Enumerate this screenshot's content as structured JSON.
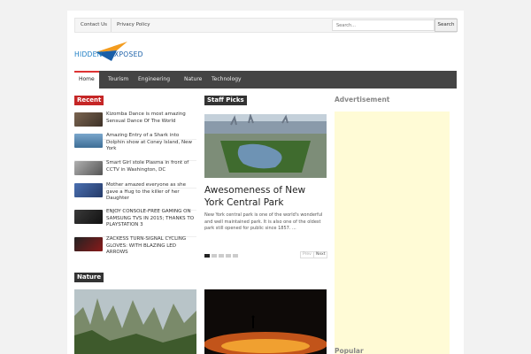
{
  "topbar": {
    "links": [
      "Contact Us",
      "Privacy Policy"
    ],
    "search_placeholder": "Search...",
    "search_button": "Search"
  },
  "logo": {
    "word1": "HIDDEN",
    "word2": "EXPOSED"
  },
  "nav": {
    "items": [
      "Home",
      "Tourism",
      "Engineering",
      "Nature",
      "Technology"
    ],
    "active": "Home"
  },
  "sections": {
    "recent": "Recent",
    "staff_picks": "Staff Picks",
    "nature": "Nature",
    "advertisement": "Advertisement",
    "popular": "Popular"
  },
  "recent_posts": [
    {
      "title": "Kizomba Dance is most amazing Sensual Dance Of The World",
      "thumb_color": "#6b5a4a"
    },
    {
      "title": "Amazing Entry of a Shark into Dolphin show at Coney Island, New York",
      "thumb_color": "#4f7fa8"
    },
    {
      "title": "Smart Girl stole Plasma in front of CCTV in Washington, DC",
      "thumb_color": "#8a8a8a"
    },
    {
      "title": "Mother amazed everyone as she gave a Hug to the killer of her Daughter",
      "thumb_color": "#3b5a9a"
    },
    {
      "title": "ENJOY CONSOLE-FREE GAMING ON SAMSUNG TVS IN 2015; THANKS TO PLAYSTATION 3",
      "thumb_color": "#2a2a2a"
    },
    {
      "title": "ZACKESS TURN-SIGNAL CYCLING GLOVES: WITH BLAZING LED ARROWS",
      "thumb_color": "#1e1e1e"
    }
  ],
  "staff_pick": {
    "title": "Awesomeness of New York Central Park",
    "description": "New York central park is one of the world's wonderful and well maintained park. It is also one of the oldest park still opened for public since 1857. ...",
    "prev": "Prev",
    "next": "Next",
    "slide_count": 5,
    "active_slide": 1
  },
  "colors": {
    "accent_red": "#c52626",
    "nav_bg": "#444444",
    "ad_bg": "#fffbd6"
  }
}
